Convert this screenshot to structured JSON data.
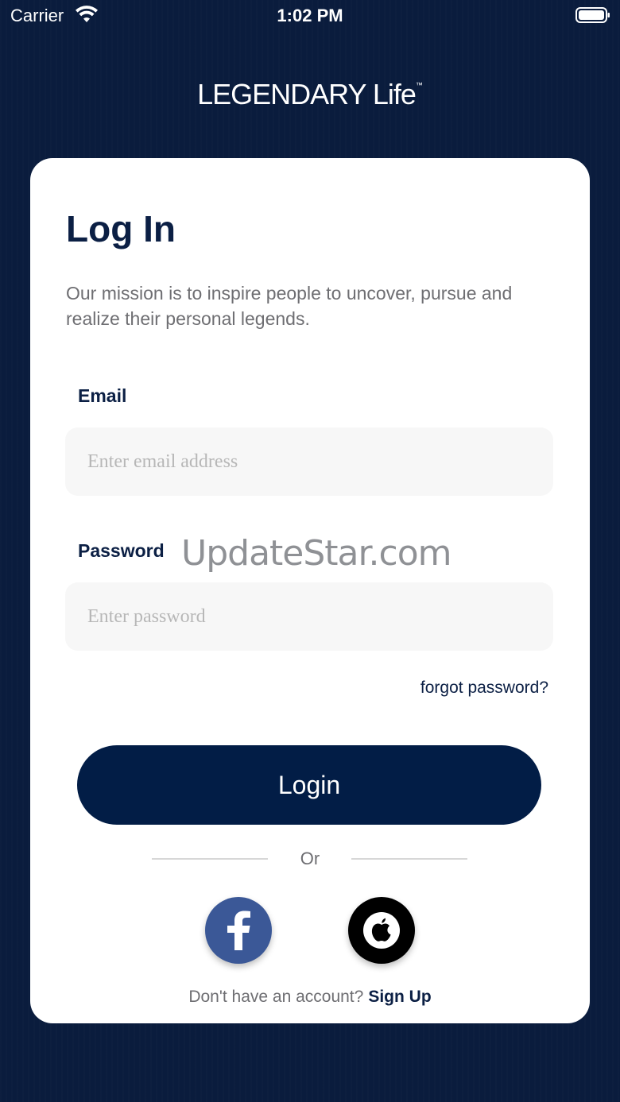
{
  "status_bar": {
    "carrier": "Carrier",
    "time": "1:02 PM"
  },
  "brand": {
    "name": "LEGENDARY Life",
    "trademark": "™"
  },
  "login": {
    "title": "Log In",
    "mission": "Our mission is to inspire people to uncover, pursue and realize their personal legends.",
    "email_label": "Email",
    "email_placeholder": "Enter email address",
    "email_value": "",
    "password_label": "Password",
    "password_placeholder": "Enter password",
    "password_value": "",
    "forgot_label": "forgot password?",
    "login_label": "Login",
    "or_label": "Or",
    "no_account_text": "Don't have an account?",
    "signup_label": "Sign Up"
  },
  "watermark": "UpdateStar.com",
  "colors": {
    "background": "#0a1c3d",
    "primary": "#021d46",
    "facebook": "#3b5897",
    "apple": "#000000",
    "field": "#f7f7f7"
  },
  "icons": {
    "wifi": "wifi-icon",
    "battery": "battery-icon",
    "facebook": "facebook-icon",
    "apple": "apple-icon"
  }
}
